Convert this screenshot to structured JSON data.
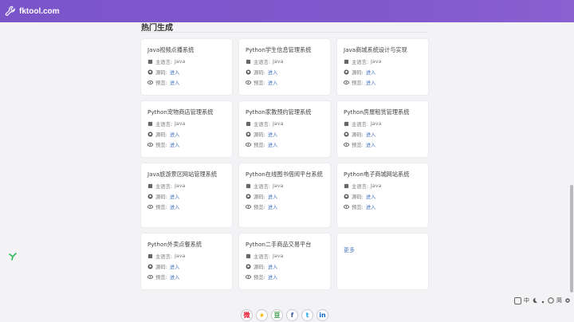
{
  "header": {
    "logo_text": "fktool.com",
    "color": "#7f58cc"
  },
  "section": {
    "title": "热门生成"
  },
  "labels": {
    "language": "主语言:",
    "source": "源码:",
    "preview": "预览:",
    "enter": "进入"
  },
  "cards": [
    {
      "title": "Java视频点播系统",
      "language": "Java"
    },
    {
      "title": "Python学生信息管理系统",
      "language": "Java"
    },
    {
      "title": "Java商城系统设计与实现",
      "language": "Java"
    },
    {
      "title": "Python宠物商店管理系统",
      "language": "Java"
    },
    {
      "title": "Python家教预约管理系统",
      "language": "Java"
    },
    {
      "title": "Python房屋租赁管理系统",
      "language": "Java"
    },
    {
      "title": "Java旅游景区网站管理系统",
      "language": "Java"
    },
    {
      "title": "Python在线图书借阅平台系统",
      "language": "Java"
    },
    {
      "title": "Python电子商城网站系统",
      "language": "Java"
    },
    {
      "title": "Python外卖点餐系统",
      "language": "Java"
    },
    {
      "title": "Python二手商品交易平台",
      "language": "Java"
    }
  ],
  "more": {
    "label": "更多"
  },
  "ime": {
    "items": [
      "中",
      "简"
    ]
  },
  "share": {
    "icons": [
      "weibo-icon",
      "qzone-icon",
      "douban-icon",
      "facebook-icon",
      "twitter-icon",
      "linkedin-icon"
    ]
  },
  "colors": {
    "link": "#4a78c2",
    "background": "#f3f3f5"
  }
}
